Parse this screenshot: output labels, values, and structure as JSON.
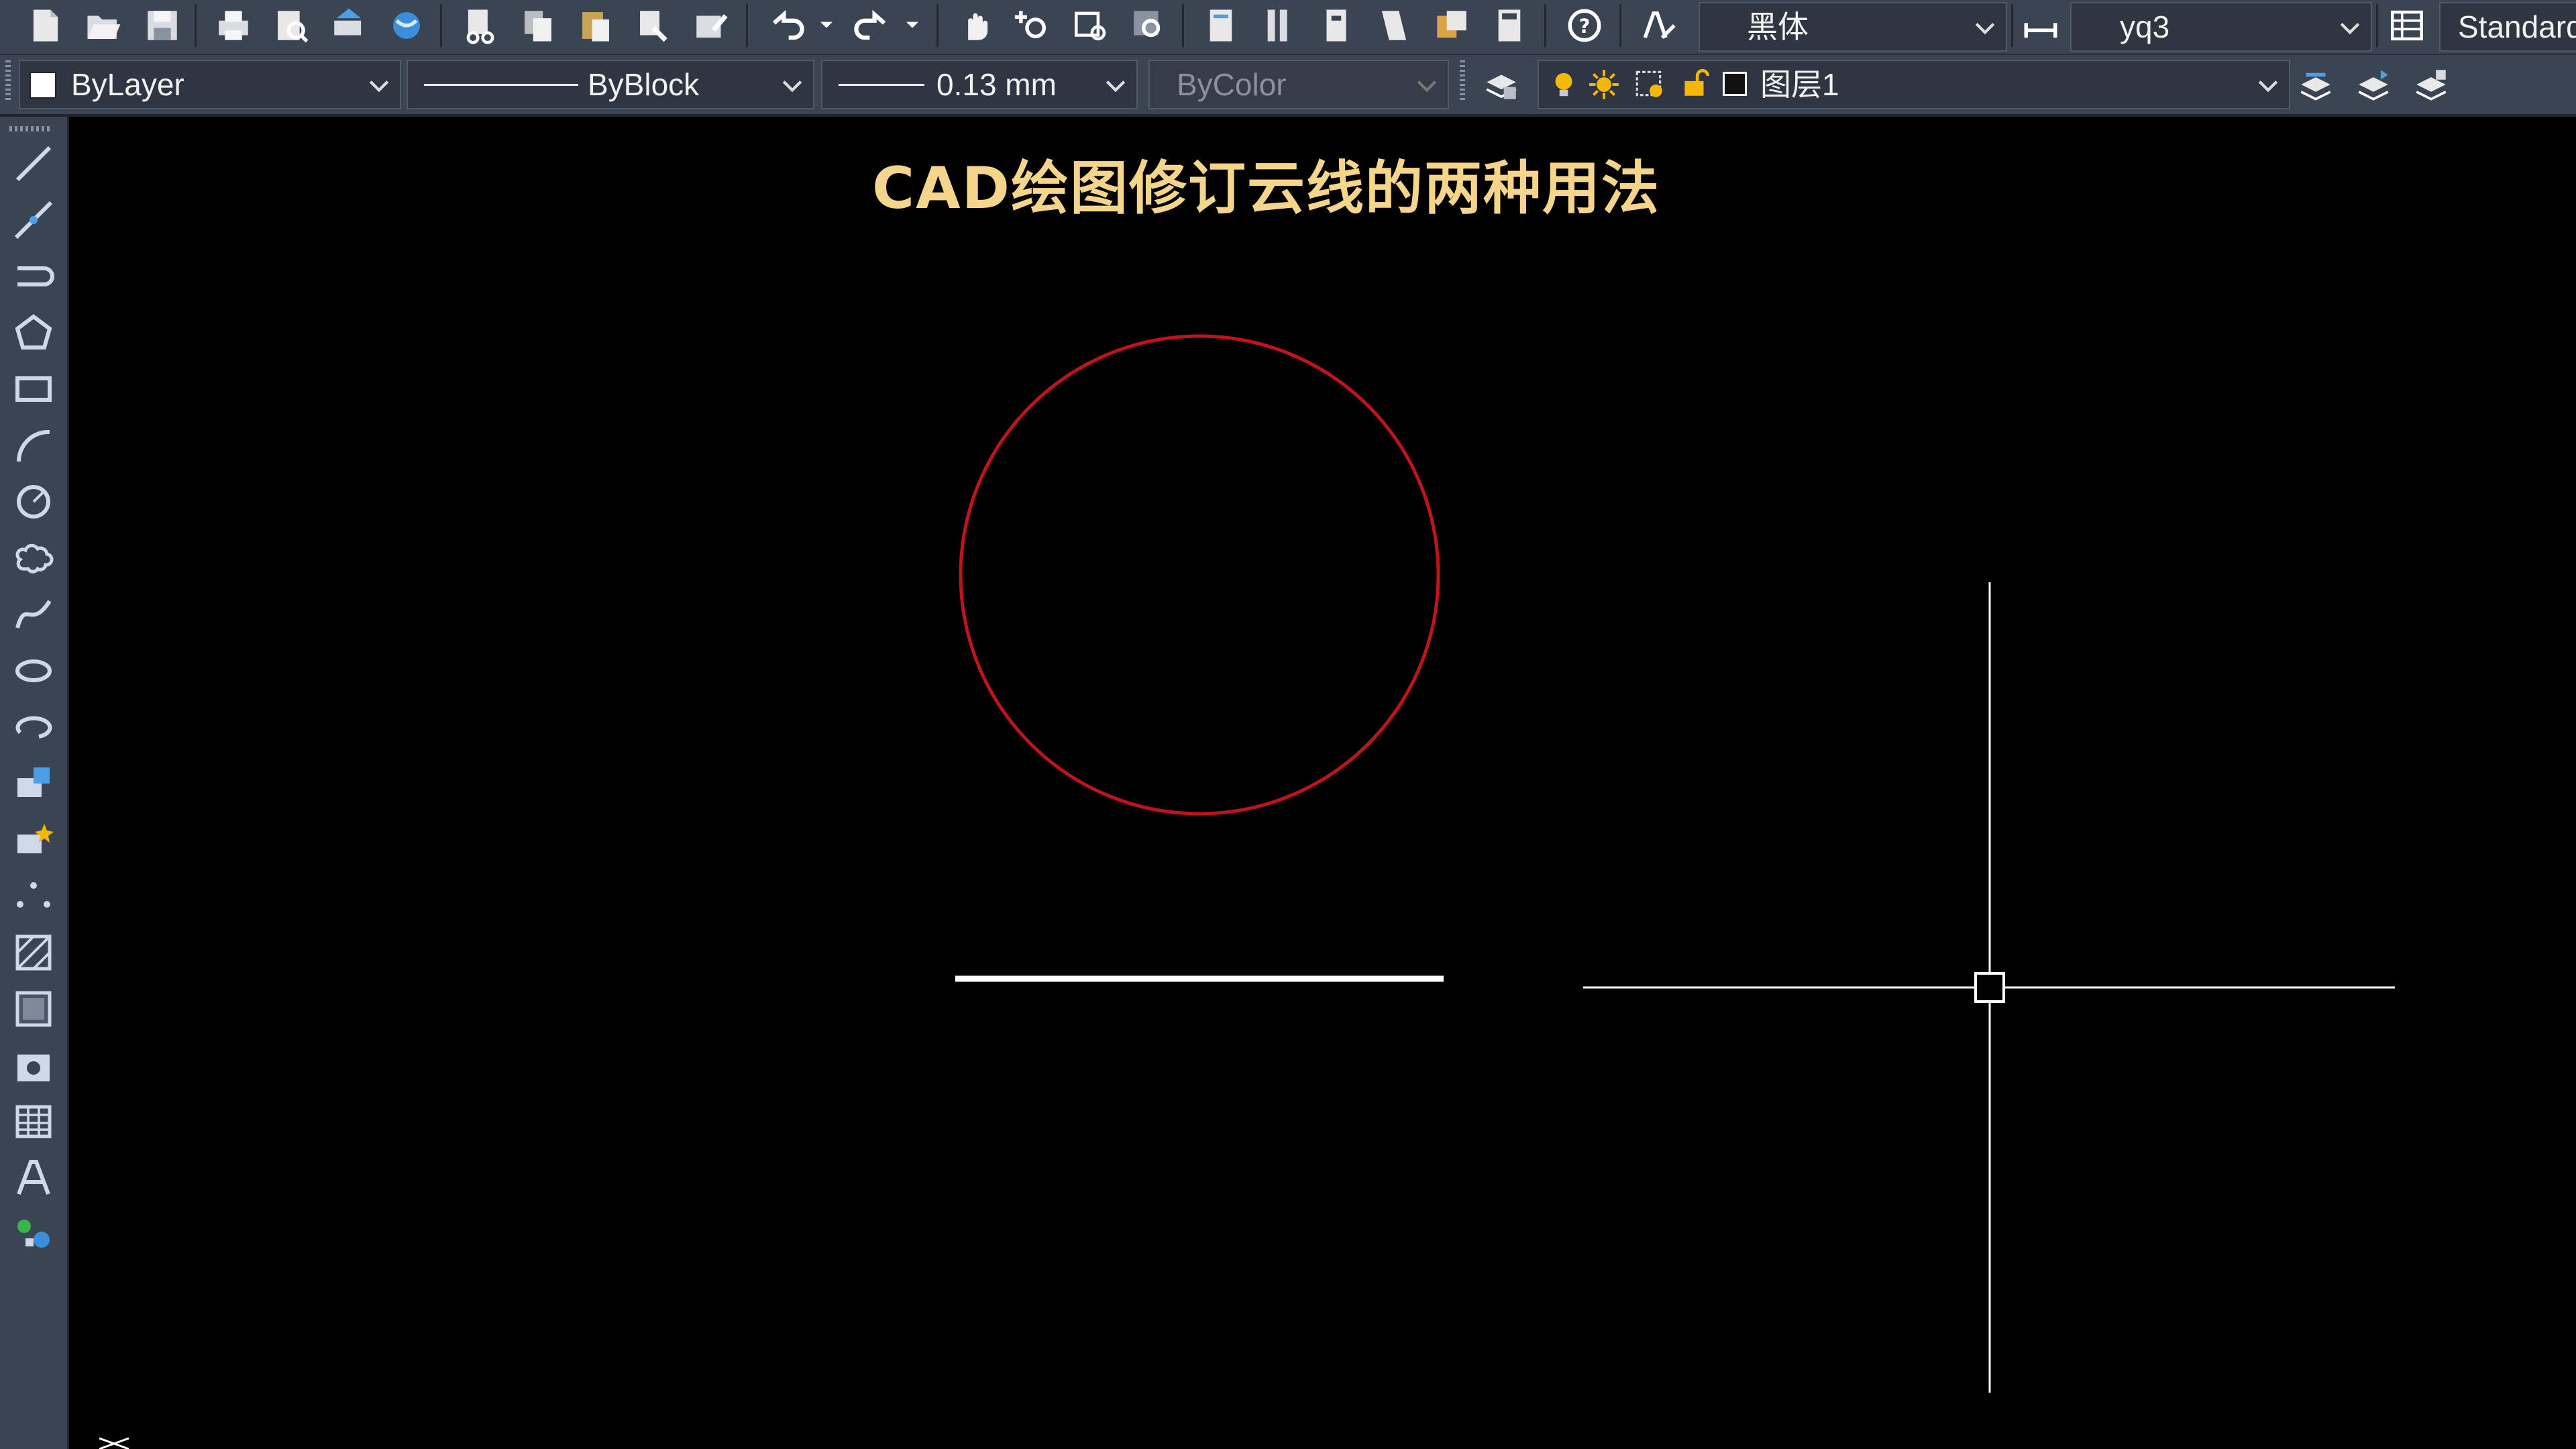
{
  "toolbar_top": {
    "font_combo": {
      "value": "黑体"
    },
    "dim_style_combo": {
      "value": "yq3"
    },
    "table_style_combo": {
      "value": "Standard"
    }
  },
  "properties_bar": {
    "color_combo": {
      "value": "ByLayer"
    },
    "linetype_combo": {
      "value": "ByBlock"
    },
    "lineweight_combo": {
      "value": "0.13 mm"
    },
    "plotstyle_combo": {
      "value": "ByColor"
    },
    "layer_combo": {
      "value": "图层1"
    }
  },
  "drawing": {
    "title": "CAD绘图修订云线的两种用法",
    "colors": {
      "title": "#f5d58a",
      "circle": "#c0141c",
      "line": "#ffffff",
      "crosshair": "#ffffff",
      "background": "#000000"
    }
  },
  "icons": {
    "top": [
      "new-icon",
      "open-icon",
      "save-icon",
      "plot-icon",
      "plot-preview-icon",
      "publish-icon",
      "3d-dwf-icon",
      "cut-icon",
      "copy-icon",
      "paste-icon",
      "match-properties-icon",
      "block-editor-icon",
      "undo-icon",
      "redo-icon",
      "pan-icon",
      "zoom-realtime-icon",
      "zoom-window-icon",
      "zoom-previous-icon",
      "properties-icon",
      "design-center-icon",
      "tool-palettes-icon",
      "sheet-set-icon",
      "markup-icon",
      "calculator-icon",
      "help-icon",
      "text-style-icon",
      "dim-style-icon",
      "table-style-icon"
    ],
    "left": [
      "line-icon",
      "construction-line-icon",
      "polyline-icon",
      "polygon-icon",
      "rectangle-icon",
      "arc-icon",
      "circle-icon",
      "revision-cloud-icon",
      "spline-icon",
      "ellipse-icon",
      "ellipse-arc-icon",
      "insert-block-icon",
      "make-block-icon",
      "point-icon",
      "hatch-icon",
      "gradient-icon",
      "region-icon",
      "table-icon",
      "multiline-text-icon",
      "add-selected-icon"
    ]
  }
}
